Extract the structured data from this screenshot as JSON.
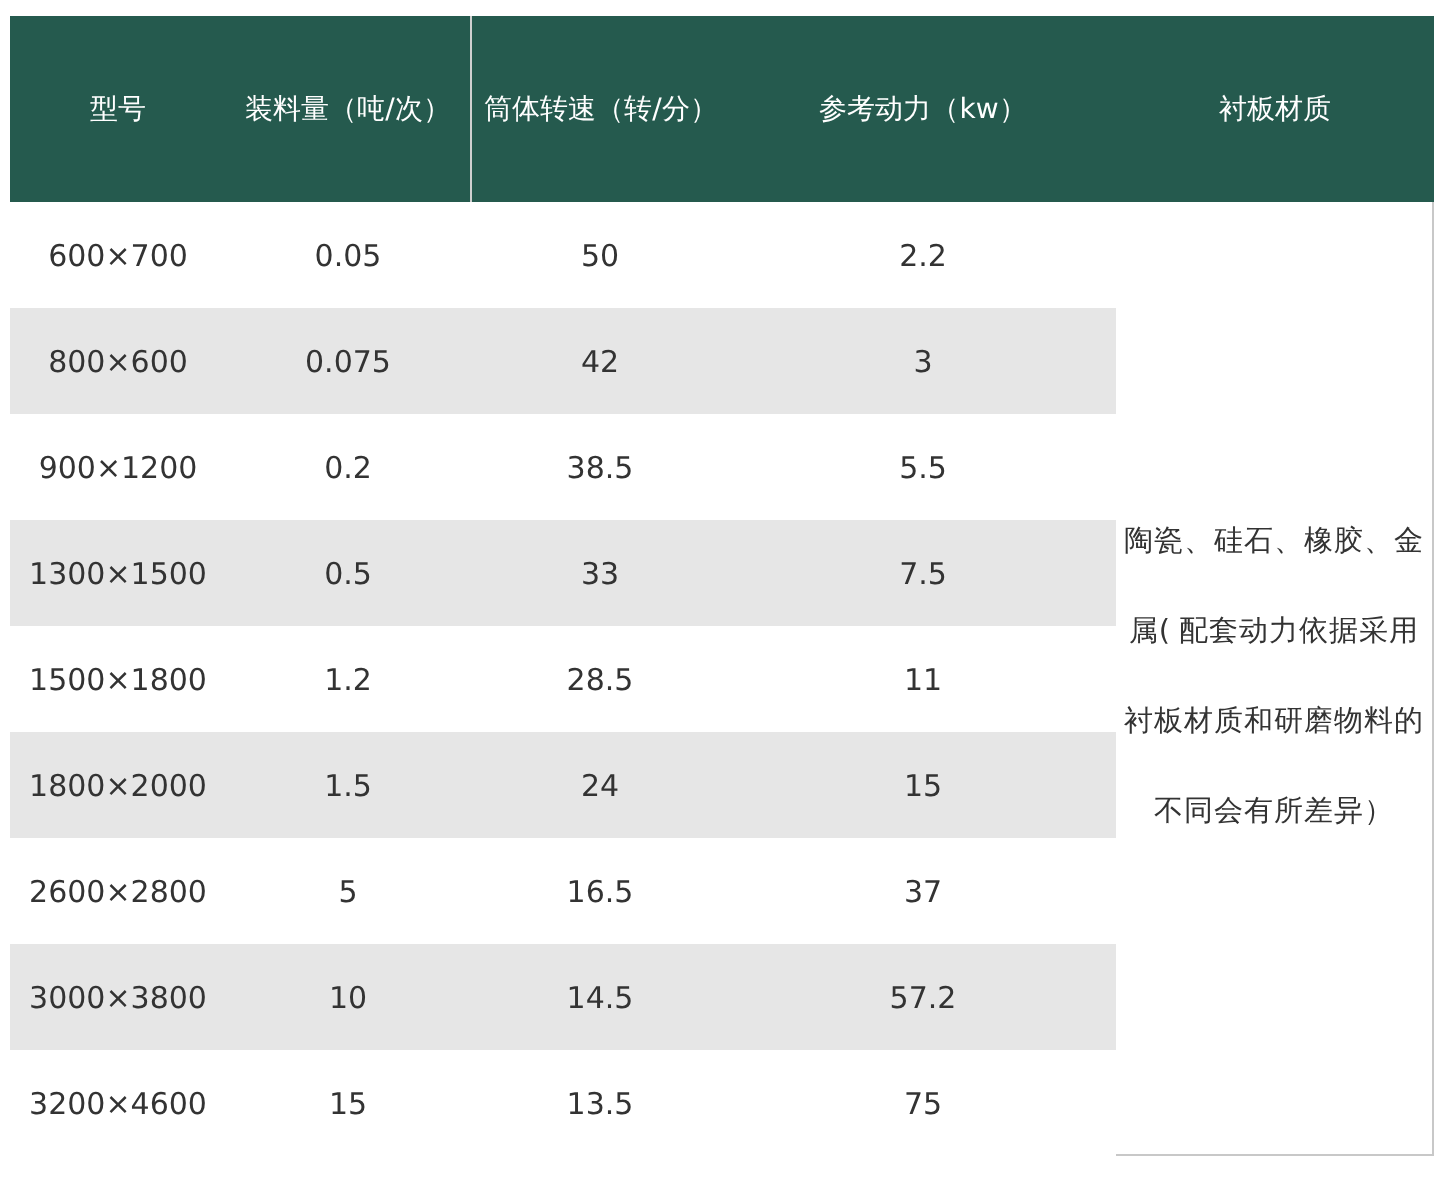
{
  "table": {
    "columns": [
      "型号",
      "装料量（吨/次）",
      "筒体转速（转/分）",
      "参考动力（kw）",
      "衬板材质"
    ],
    "rows": [
      [
        "600×700",
        "0.05",
        "50",
        "2.2"
      ],
      [
        "800×600",
        "0.075",
        "42",
        "3"
      ],
      [
        "900×1200",
        "0.2",
        "38.5",
        "5.5"
      ],
      [
        "1300×1500",
        "0.5",
        "33",
        "7.5"
      ],
      [
        "1500×1800",
        "1.2",
        "28.5",
        "11"
      ],
      [
        "1800×2000",
        "1.5",
        "24",
        "15"
      ],
      [
        "2600×2800",
        "5",
        "16.5",
        "37"
      ],
      [
        "3000×3800",
        "10",
        "14.5",
        "57.2"
      ],
      [
        "3200×4600",
        "15",
        "13.5",
        "75"
      ]
    ],
    "note": "陶瓷、硅石、橡胶、金属( 配套动力依据采用衬板材质和研磨物料的不同会有所差异）"
  }
}
